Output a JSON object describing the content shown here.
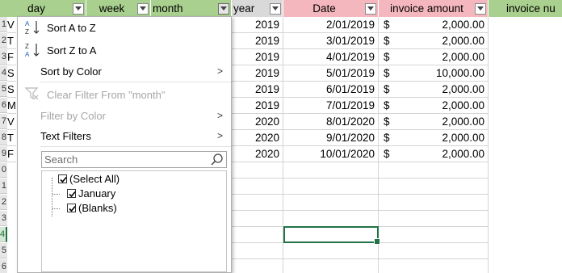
{
  "columns": {
    "day": "day",
    "week": "week",
    "month": "month",
    "year": "year",
    "date": "Date",
    "invoice_amount": "invoice amount",
    "invoice_number": "invoice nu"
  },
  "row_headers": [
    "1",
    "2",
    "3",
    "4",
    "5",
    "6",
    "7",
    "8",
    "9",
    "0",
    "1",
    "2",
    "3",
    "4",
    "5",
    "6",
    "7"
  ],
  "lead_letters": [
    "V",
    "T",
    "F",
    "S",
    "S",
    "M",
    "V",
    "T",
    "F"
  ],
  "rows": [
    {
      "year": "2019",
      "date": "2/01/2019",
      "currency": "$",
      "amount": "2,000.00"
    },
    {
      "year": "2019",
      "date": "3/01/2019",
      "currency": "$",
      "amount": "2,000.00"
    },
    {
      "year": "2019",
      "date": "4/01/2019",
      "currency": "$",
      "amount": "2,000.00"
    },
    {
      "year": "2019",
      "date": "5/01/2019",
      "currency": "$",
      "amount": "10,000.00"
    },
    {
      "year": "2019",
      "date": "6/01/2019",
      "currency": "$",
      "amount": "2,000.00"
    },
    {
      "year": "2019",
      "date": "7/01/2019",
      "currency": "$",
      "amount": "2,000.00"
    },
    {
      "year": "2020",
      "date": "8/01/2020",
      "currency": "$",
      "amount": "2,000.00"
    },
    {
      "year": "2020",
      "date": "9/01/2020",
      "currency": "$",
      "amount": "2,000.00"
    },
    {
      "year": "2020",
      "date": "10/01/2020",
      "currency": "$",
      "amount": "2,000.00"
    }
  ],
  "menu": {
    "sort_az": "Sort A to Z",
    "sort_za": "Sort Z to A",
    "sort_color": "Sort by Color",
    "clear_filter": "Clear Filter From \"month\"",
    "filter_color": "Filter by Color",
    "text_filters": "Text Filters",
    "arrow": ">",
    "search_placeholder": "Search",
    "items": [
      {
        "label": "(Select All)",
        "checked": true
      },
      {
        "label": "January",
        "checked": true
      },
      {
        "label": "(Blanks)",
        "checked": true
      }
    ],
    "sort_icon_a": "A",
    "sort_icon_z": "Z"
  },
  "colors": {
    "green_header": "#a9d08e",
    "gray_header": "#d9d9d9",
    "pink_header": "#f4b7bd",
    "selection": "#217346"
  }
}
